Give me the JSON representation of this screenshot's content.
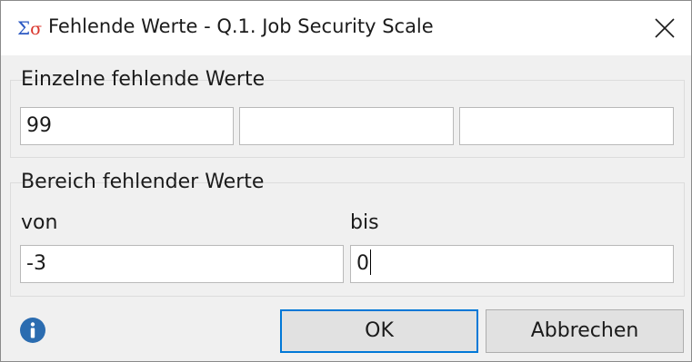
{
  "window": {
    "title": "Fehlende Werte - Q.1. Job Security Scale",
    "app_icon": "sigma-icon",
    "close_icon": "close-icon"
  },
  "single_missing": {
    "label": "Einzelne fehlende Werte",
    "values": [
      "99",
      "",
      ""
    ]
  },
  "range_missing": {
    "label": "Bereich fehlender Werte",
    "from_label": "von",
    "to_label": "bis",
    "from_value": "-3",
    "to_value": "0"
  },
  "footer": {
    "info_icon": "info-icon",
    "ok_label": "OK",
    "cancel_label": "Abbrechen"
  },
  "colors": {
    "accent": "#0078d7",
    "info": "#2b6cb0"
  }
}
